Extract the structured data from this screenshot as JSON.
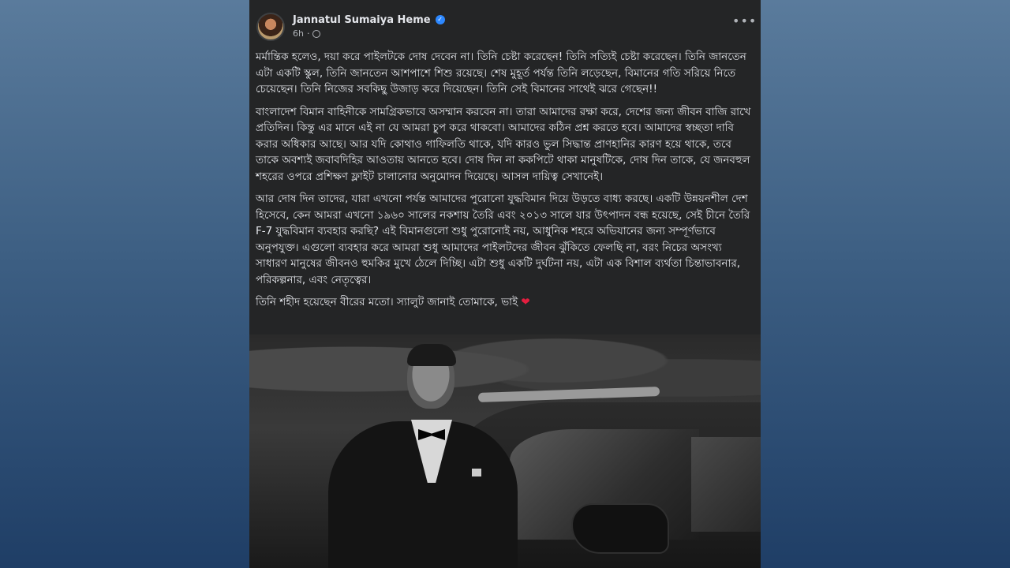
{
  "post": {
    "author": "Jannatul Sumaiya Heme",
    "verified_mark": "✓",
    "time": "6h",
    "audience_icon": "globe-icon",
    "more_label": "•••",
    "paragraphs": [
      "মর্মান্তিক হলেও, দয়া করে পাইলটকে দোষ দেবেন না। তিনি চেষ্টা করেছেন! তিনি সত্যিই চেষ্টা করেছেন। তিনি জানতেন এটা একটি স্কুল, তিনি জানতেন আশপাশে শিশু রয়েছে। শেষ মুহূর্ত পর্যন্ত তিনি লড়েছেন, বিমানের গতি সরিয়ে নিতে চেয়েছেন। তিনি নিজের সবকিছু উজাড় করে দিয়েছেন। তিনি সেই বিমানের সাথেই ঝরে গেছেন!!",
      "বাংলাদেশ বিমান বাহিনীকে সামগ্রিকভাবে অসম্মান করবেন না। তারা আমাদের রক্ষা করে, দেশের জন্য জীবন বাজি রাখে প্রতিদিন। কিন্তু এর মানে এই না যে আমরা চুপ করে থাকবো। আমাদের কঠিন প্রশ্ন করতে হবে। আমাদের স্বচ্ছতা দাবি করার অধিকার আছে। আর যদি কোথাও গাফিলতি থাকে, যদি কারও ভুল সিদ্ধান্ত প্রাণহানির কারণ হয়ে থাকে, তবে তাকে অবশ্যই জবাবদিহির আওতায় আনতে হবে। দোষ দিন না ককপিটে থাকা মানুষটিকে, দোষ দিন তাকে, যে জনবহুল শহরের ওপরে প্রশিক্ষণ ফ্লাইট চালানোর অনুমোদন দিয়েছে। আসল দায়িত্ব সেখানেই।",
      "আর দোষ দিন তাদের, যারা এখনো পর্যন্ত আমাদের পুরোনো যুদ্ধবিমান দিয়ে উড়তে বাধ্য করছে। একটি উন্নয়নশীল দেশ হিসেবে, কেন আমরা এখনো ১৯৬০ সালের নকশায় তৈরি এবং ২০১৩ সালে যার উৎপাদন বন্ধ হয়েছে, সেই চীনে তৈরি F-7 যুদ্ধবিমান ব্যবহার করছি? এই বিমানগুলো শুধু পুরোনোই নয়, আধুনিক শহরে অভিযানের জন্য সম্পূর্ণভাবে অনুপযুক্ত। এগুলো ব্যবহার করে আমরা শুধু আমাদের পাইলটদের জীবন ঝুঁকিতে ফেলছি না, বরং নিচের অসংখ্য সাধারণ মানুষের জীবনও হুমকির মুখে ঠেলে দিচ্ছি। এটা শুধু একটি দুর্ঘটনা নয়, এটা এক বিশাল ব্যর্থতা চিন্তাভাবনার, পরিকল্পনার, এবং নেতৃত্বের।",
      "তিনি শহীদ হয়েছেন বীরের মতো। স্যালুট জানাই তোমাকে, ভাই"
    ],
    "heart": "❤",
    "photo_icon": "photo-image"
  },
  "colors": {
    "post_bg": "#242526",
    "text": "#e4e6eb",
    "meta": "#b0b3b8",
    "verified": "#2d88ff",
    "heart": "#e41e3f"
  }
}
